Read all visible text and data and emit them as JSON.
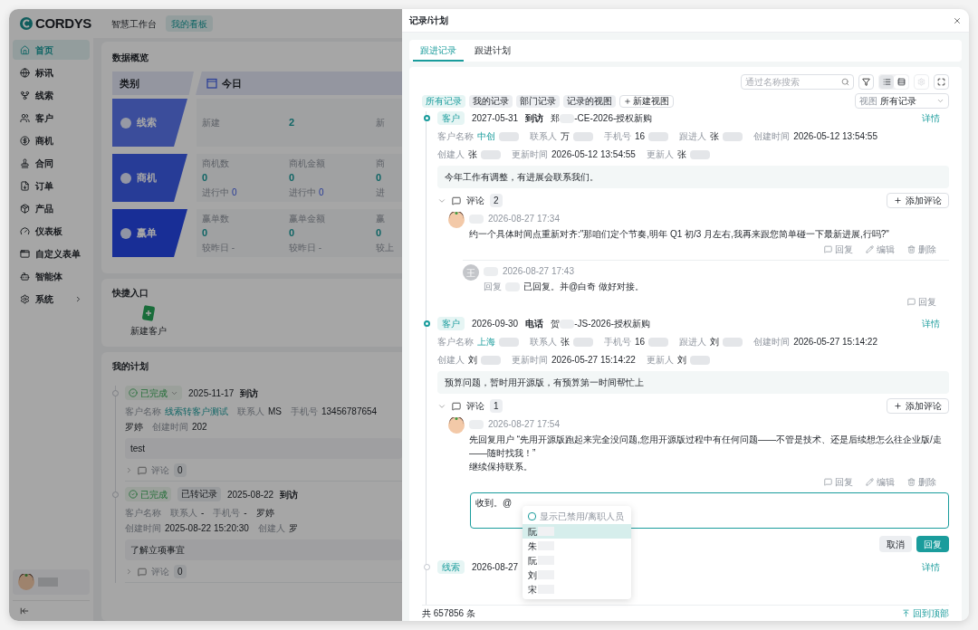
{
  "app": {
    "logo": "CORDYS",
    "top_tabs": [
      {
        "label": "智慧工作台",
        "selected": false
      },
      {
        "label": "我的看板",
        "selected": true
      }
    ],
    "sidebar": {
      "items": [
        {
          "label": "首页",
          "selected": true
        },
        {
          "label": "标讯",
          "selected": false
        },
        {
          "label": "线索",
          "selected": false
        },
        {
          "label": "客户",
          "selected": false
        },
        {
          "label": "商机",
          "selected": false
        },
        {
          "label": "合同",
          "selected": false
        },
        {
          "label": "订单",
          "selected": false
        },
        {
          "label": "产品",
          "selected": false
        },
        {
          "label": "仪表板",
          "selected": false
        },
        {
          "label": "自定义表单",
          "selected": false
        },
        {
          "label": "智能体",
          "selected": false
        },
        {
          "label": "系统",
          "selected": false,
          "has_children": true
        }
      ]
    },
    "overview": {
      "title": "数据概览",
      "category_header": "类别",
      "period_header": "今日",
      "rows": [
        {
          "kind": "lead",
          "label": "线索",
          "cells": [
            {
              "label": "新建"
            },
            {
              "value": "2"
            },
            {
              "label": "新"
            }
          ]
        },
        {
          "kind": "opportunity",
          "label": "商机",
          "cells": [
            {
              "label": "商机数",
              "value": "0",
              "sub": "进行中",
              "sub_value": "0"
            },
            {
              "label": "商机金额",
              "value": "0",
              "sub": "进行中",
              "sub_value": "0"
            },
            {
              "label": "商",
              "value": "0",
              "sub": "进"
            }
          ]
        },
        {
          "kind": "win",
          "label": "赢单",
          "cells": [
            {
              "label": "赢单数",
              "value": "0",
              "sub": "较昨日 -"
            },
            {
              "label": "赢单金额",
              "value": "0",
              "sub": "较昨日 -"
            },
            {
              "label": "赢",
              "value": "0",
              "sub": "较上"
            }
          ]
        }
      ]
    },
    "quick_entry": {
      "title": "快捷入口",
      "items": [
        {
          "label": "新建客户"
        }
      ]
    },
    "plans": {
      "title": "我的计划",
      "items": [
        {
          "status": "已完成",
          "status_dropdown": true,
          "date": "2025-11-17",
          "type": "到访",
          "fields": [
            {
              "label": "客户名称",
              "value": "线索转客户测试",
              "link": true
            },
            {
              "label": "联系人",
              "value": "MS"
            },
            {
              "label": "手机号",
              "value": "13456787654"
            },
            {
              "value": "罗婷"
            },
            {
              "label": "创建时间",
              "value": "202"
            }
          ],
          "content": "test",
          "comments_label": "评论",
          "comment_count": "0"
        },
        {
          "status": "已完成",
          "status_dropdown": false,
          "badge": "已转记录",
          "date": "2025-08-22",
          "type": "到访",
          "fields": [
            {
              "label": "客户名称"
            },
            {
              "label": "联系人",
              "value": "-"
            },
            {
              "label": "手机号",
              "value": "-"
            },
            {
              "value": "罗婷"
            },
            {
              "label": "创建时间",
              "value": "2025-08-22 15:20:30"
            },
            {
              "label": "创建人",
              "value": "罗"
            }
          ],
          "content": "了解立项事宜",
          "comments_label": "评论",
          "comment_count": "0"
        }
      ]
    }
  },
  "drawer": {
    "title": "记录/计划",
    "tabs": [
      {
        "label": "跟进记录",
        "selected": true
      },
      {
        "label": "跟进计划",
        "selected": false
      }
    ],
    "search": {
      "placeholder": "通过名称搜索"
    },
    "view_modes": [
      {
        "kind": "list",
        "selected": true
      },
      {
        "kind": "detail",
        "selected": false
      }
    ],
    "settings_disabled": true,
    "view_chips": [
      {
        "label": "所有记录",
        "selected": true
      },
      {
        "label": "我的记录",
        "selected": false
      },
      {
        "label": "部门记录",
        "selected": false
      },
      {
        "label": "记录的视图",
        "selected": false
      }
    ],
    "new_view": "新建视图",
    "view_select": {
      "label": "视图",
      "value": "所有记录"
    },
    "records": [
      {
        "tag": "客户",
        "date": "2027-05-31",
        "type": "到访",
        "title_start": "郑",
        "title_end": "-CE-2026-授权新购",
        "detail": "详情",
        "active": true,
        "fields": [
          {
            "label": "客户名称",
            "value": "中创",
            "link": true,
            "redacted": true
          },
          {
            "label": "联系人",
            "value": "万",
            "redacted": true
          },
          {
            "label": "手机号",
            "value": "16",
            "redacted": true
          },
          {
            "label": "跟进人",
            "value": "张",
            "redacted": true
          },
          {
            "label": "创建时间",
            "value": "2026-05-12 13:54:55"
          },
          {
            "label": "创建人",
            "value": "张",
            "redacted": true
          },
          {
            "label": "更新时间",
            "value": "2026-05-12 13:54:55"
          },
          {
            "label": "更新人",
            "value": "张",
            "redacted": true
          }
        ],
        "content": "今年工作有调整，有进展会联系我们。",
        "comments": {
          "label": "评论",
          "count": "2",
          "expanded": true,
          "add": "添加评论",
          "items": [
            {
              "kind": "comment",
              "date": "2026-08-27 17:34",
              "text": "约一个具体时间点重新对齐:\"那咱们定个节奏,明年 Q1 初/3 月左右,我再来跟您简单碰一下最新进展,行吗?\"",
              "actions": [
                "回复",
                "编辑",
                "删除"
              ]
            },
            {
              "kind": "reply",
              "avatar_letter": "王",
              "date": "2026-08-27 17:43",
              "reply_label": "回复",
              "text": "已回复。并@白奇 做好对接。",
              "actions": [
                "回复"
              ]
            }
          ]
        }
      },
      {
        "tag": "客户",
        "date": "2026-09-30",
        "type": "电话",
        "title_start": "贺",
        "title_end": "-JS-2026-授权新购",
        "detail": "详情",
        "active": true,
        "fields": [
          {
            "label": "客户名称",
            "value": "上海",
            "link": true,
            "redacted": true
          },
          {
            "label": "联系人",
            "value": "张",
            "redacted": true
          },
          {
            "label": "手机号",
            "value": "16",
            "redacted": true
          },
          {
            "label": "跟进人",
            "value": "刘",
            "redacted": true
          },
          {
            "label": "创建时间",
            "value": "2026-05-27 15:14:22"
          },
          {
            "label": "创建人",
            "value": "刘",
            "redacted": true
          },
          {
            "label": "更新时间",
            "value": "2026-05-27 15:14:22"
          },
          {
            "label": "更新人",
            "value": "刘",
            "redacted": true
          }
        ],
        "content": "预算问题，暂时用开源版，有预算第一时间帮忙上",
        "comments": {
          "label": "评论",
          "count": "1",
          "expanded": true,
          "add": "添加评论",
          "items": [
            {
              "kind": "comment",
              "date": "2026-08-27 17:54",
              "text": "先回复用户 “先用开源版跑起来完全没问题,您用开源版过程中有任何问题——不管是技术、还是后续想怎么往企业版/走——随时找我！”\n继续保持联系。",
              "actions": [
                "回复",
                "编辑",
                "删除"
              ]
            }
          ],
          "editor": {
            "value": "收到。@",
            "cancel": "取消",
            "submit": "回复",
            "mention": {
              "checkbox_label": "显示已禁用/离职人员",
              "checked": false,
              "users": [
                {
                  "name": "阮",
                  "selected": true
                },
                {
                  "name": "朱",
                  "selected": false
                },
                {
                  "name": "阮",
                  "selected": false
                },
                {
                  "name": "刘",
                  "selected": false
                },
                {
                  "name": "宋",
                  "selected": false
                }
              ]
            }
          }
        }
      },
      {
        "tag": "线索",
        "date": "2026-08-27",
        "detail": "详情",
        "active": false
      }
    ],
    "footer": {
      "total": "共 657856 条",
      "back_to_top": "回到顶部"
    }
  }
}
